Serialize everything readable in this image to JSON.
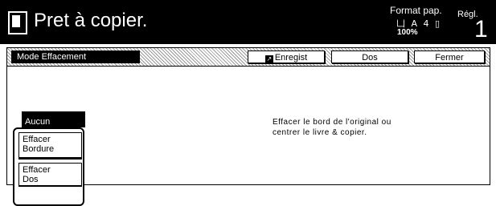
{
  "header": {
    "title": "Pret à copier.",
    "paper_format_label": "Format pap.",
    "paper_format_icons": "凵 A 4 ▯",
    "zoom": "100%",
    "settings_label": "Régl.",
    "copy_count": "1"
  },
  "panel": {
    "mode_label": "Mode Effacement",
    "buttons": {
      "save": "Enregist",
      "back": "Dos",
      "close": "Fermer"
    },
    "options": {
      "none": "Aucun",
      "border_line1": "Effacer",
      "border_line2": "Bordure",
      "spine_line1": "Effacer",
      "spine_line2": "Dos"
    },
    "description": {
      "line1": "Effacer le bord de l'original ou",
      "line2": "centrer le livre & copier."
    }
  }
}
